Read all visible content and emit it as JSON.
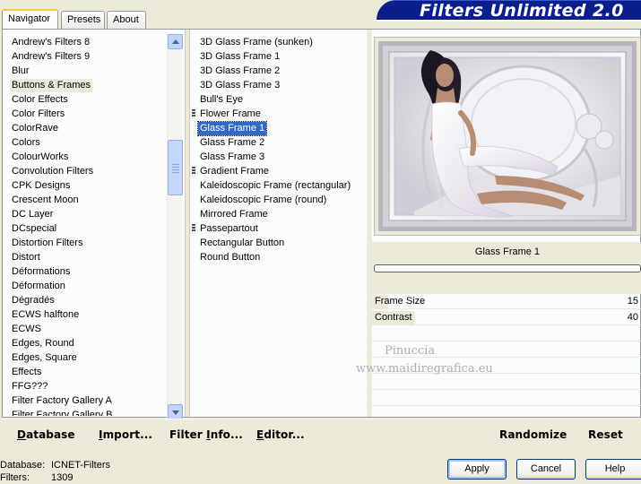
{
  "tabs": [
    {
      "label": "Navigator",
      "active": true
    },
    {
      "label": "Presets",
      "active": false
    },
    {
      "label": "About",
      "active": false
    }
  ],
  "banner": {
    "title": "Filters Unlimited 2.0"
  },
  "categories": [
    "Andrew's Filters 8",
    "Andrew's Filters 9",
    "Blur",
    "Buttons & Frames",
    "Color Effects",
    "Color Filters",
    "ColorRave",
    "Colors",
    "ColourWorks",
    "Convolution Filters",
    "CPK Designs",
    "Crescent Moon",
    "DC Layer",
    "DCspecial",
    "Distortion Filters",
    "Distort",
    "Déformations",
    "Déformation",
    "Dégradés",
    "ECWS halftone",
    "ECWS",
    "Edges, Round",
    "Edges, Square",
    "Effects",
    "FFG???",
    "Filter Factory Gallery A",
    "Filter Factory Gallery B"
  ],
  "selected_category": "Buttons & Frames",
  "filters": [
    {
      "label": "3D Glass Frame (sunken)",
      "group": false
    },
    {
      "label": "3D Glass Frame 1",
      "group": false
    },
    {
      "label": "3D Glass Frame 2",
      "group": false
    },
    {
      "label": "3D Glass Frame 3",
      "group": false
    },
    {
      "label": "Bull's Eye",
      "group": false
    },
    {
      "label": "Flower Frame",
      "group": true
    },
    {
      "label": "Glass Frame 1",
      "group": false
    },
    {
      "label": "Glass Frame 2",
      "group": false
    },
    {
      "label": "Glass Frame 3",
      "group": false
    },
    {
      "label": "Gradient Frame",
      "group": true
    },
    {
      "label": "Kaleidoscopic Frame (rectangular)",
      "group": false
    },
    {
      "label": "Kaleidoscopic Frame (round)",
      "group": false
    },
    {
      "label": "Mirrored Frame",
      "group": false
    },
    {
      "label": "Passepartout",
      "group": true
    },
    {
      "label": "Rectangular Button",
      "group": false
    },
    {
      "label": "Round Button",
      "group": false
    }
  ],
  "selected_filter": "Glass Frame 1",
  "preview": {
    "filter_name": "Glass Frame 1",
    "progress": 0
  },
  "params": [
    {
      "label": "Frame Size",
      "value": "15",
      "fraction": 0.06
    },
    {
      "label": "Contrast",
      "value": "40",
      "fraction": 0.16
    }
  ],
  "watermark": {
    "line1": "Pinuccia",
    "line2": "www.maidiregrafica.eu"
  },
  "toolbar": {
    "database": {
      "accel": "D",
      "rest": "atabase"
    },
    "import": {
      "accel": "I",
      "rest": "mport..."
    },
    "filter_info": {
      "pre": "Filter ",
      "accel": "I",
      "rest": "nfo..."
    },
    "editor": {
      "accel": "E",
      "rest": "ditor..."
    },
    "randomize": "Randomize",
    "reset": "Reset"
  },
  "status": {
    "database_label": "Database:",
    "database_value": "ICNET-Filters",
    "filters_label": "Filters:",
    "filters_value": "1309"
  },
  "buttons": {
    "apply": "Apply",
    "cancel": "Cancel",
    "help": "Help"
  },
  "colors": {
    "selection": "#316ac5",
    "banner": "#0a1e8c",
    "face": "#ece9d8"
  }
}
